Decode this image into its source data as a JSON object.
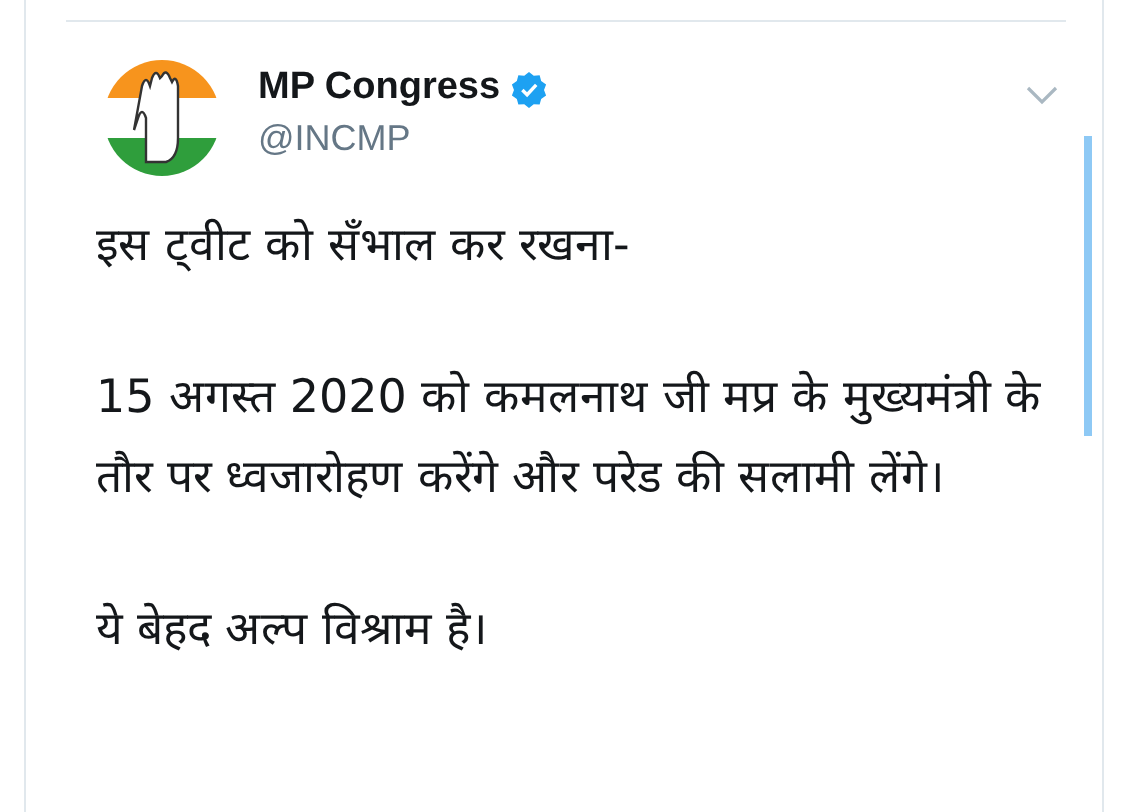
{
  "tweet": {
    "author": {
      "name": "MP Congress",
      "verified": true,
      "handle": "@INCMP"
    },
    "paragraphs": [
      "इस ट्वीट को सँभाल कर रखना-",
      "15 अगस्त 2020 को कमलनाथ जी मप्र के मुख्यमंत्री के तौर पर ध्वजारोहण करेंगे और परेड की सलामी लेंगे।",
      "ये बेहद अल्प विश्राम है।"
    ]
  }
}
